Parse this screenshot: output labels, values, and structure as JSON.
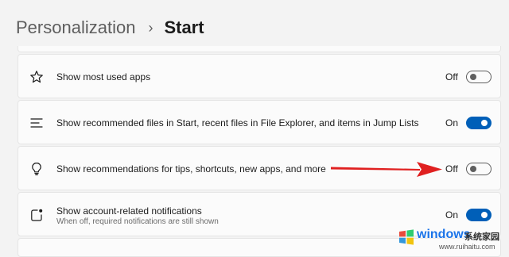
{
  "breadcrumb": {
    "parent": "Personalization",
    "separator": "›",
    "current": "Start"
  },
  "settings": [
    {
      "icon": "star-icon",
      "label": "Show most used apps",
      "sublabel": "",
      "state": "Off",
      "enabled": false
    },
    {
      "icon": "list-icon",
      "label": "Show recommended files in Start, recent files in File Explorer, and items in Jump Lists",
      "sublabel": "",
      "state": "On",
      "enabled": true
    },
    {
      "icon": "lightbulb-icon",
      "label": "Show recommendations for tips, shortcuts, new apps, and more",
      "sublabel": "",
      "state": "Off",
      "enabled": false
    },
    {
      "icon": "notification-icon",
      "label": "Show account-related notifications",
      "sublabel": "When off, required notifications are still shown",
      "state": "On",
      "enabled": true
    }
  ],
  "colors": {
    "accent": "#005fb8",
    "annotation_arrow": "#e02020",
    "background": "#f3f3f3",
    "card": "#fbfbfb"
  },
  "watermark": {
    "brand": "windows",
    "brand_cn": "系统家园",
    "url": "www.ruihaitu.com"
  }
}
